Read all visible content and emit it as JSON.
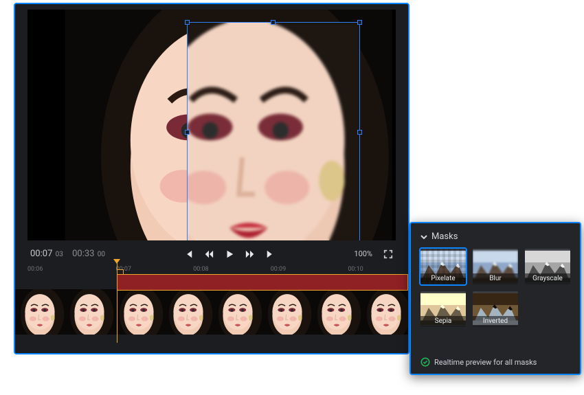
{
  "preview": {
    "current_time": "00:07",
    "current_frames": "03",
    "total_time": "00:33",
    "total_frames": "00",
    "zoom": "100%"
  },
  "timeline": {
    "ticks": [
      "00:06",
      "00:07",
      "00:08",
      "00:09",
      "00:10"
    ]
  },
  "masks": {
    "title": "Masks",
    "items": [
      {
        "label": "Pixelate",
        "selected": true
      },
      {
        "label": "Blur",
        "selected": false
      },
      {
        "label": "Grayscale",
        "selected": false
      },
      {
        "label": "Sepia",
        "selected": false
      },
      {
        "label": "Inverted",
        "selected": false
      }
    ],
    "footer": "Realtime preview for all masks"
  }
}
